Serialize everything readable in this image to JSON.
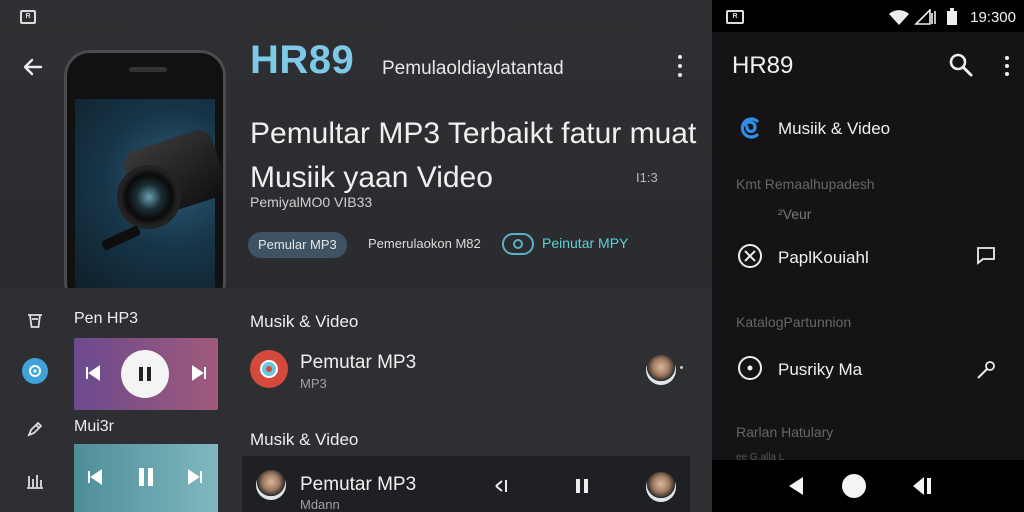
{
  "left": {
    "status_icon_label": "R",
    "brand": "HR89",
    "brand_sub": "Pemulaoldiaylatantad",
    "headline": "Pemultar MP3 Terbaikt fatur muat Musiik yaan  Video",
    "headline_badge": "I1:3",
    "subline": "PemiyalMO0 VIB33",
    "chips": [
      "Pemular MP3",
      "Pemerulaokon M82",
      "Peinutar MPY"
    ],
    "rail_labels": {
      "top": "Pen HP3",
      "bottom": "Mui3r"
    },
    "section1_title": "Musik & Video",
    "row1": {
      "title": "Pemutar MP3",
      "sub": "MP3"
    },
    "section2_title": "Musik & Video",
    "row2": {
      "title": "Pemutar MP3",
      "sub": "Mdann"
    },
    "colors": {
      "brand": "#7ec8e8",
      "accent": "#3fa3d8",
      "chip_text": "#5ed1d6"
    }
  },
  "right": {
    "status_icon_label": "R",
    "time": "19:300",
    "title": "HR89",
    "items": [
      {
        "label": "Musiik & Video",
        "icon": "music-video-icon"
      },
      {
        "label": "PaplKouiahl",
        "icon": "close-circle-icon",
        "trail": "chat-icon"
      },
      {
        "label": "Pusriky Ma",
        "icon": "record-icon",
        "trail": "mic-icon"
      }
    ],
    "sections": [
      "Kmt   Remaalhupadesh",
      "²Veur",
      "KatalogPartunnion",
      "Rarlan Hatulary"
    ],
    "bottom_peek": "ee  G.alla L"
  }
}
